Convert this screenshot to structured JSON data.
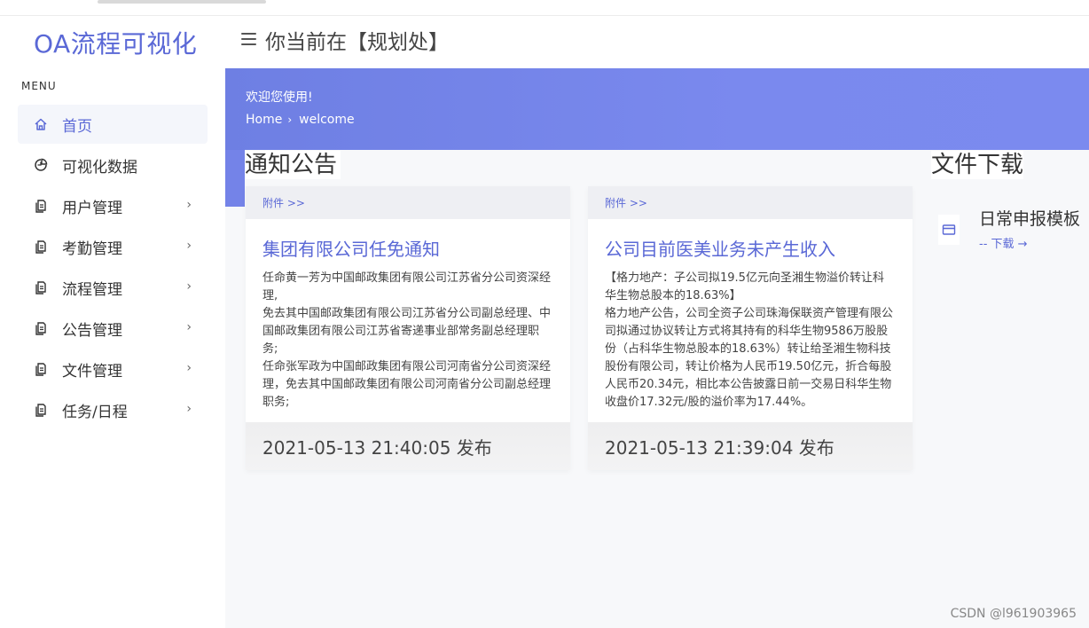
{
  "app": {
    "logo": "OA流程可视化"
  },
  "header": {
    "location": "你当前在【规划处】"
  },
  "sidebar": {
    "caption": "MENU",
    "items": [
      {
        "label": "首页",
        "icon": "home-icon",
        "active": true
      },
      {
        "label": "可视化数据",
        "icon": "chart-icon"
      },
      {
        "label": "用户管理",
        "icon": "document-icon",
        "chevron": "›"
      },
      {
        "label": "考勤管理",
        "icon": "document-icon",
        "chevron": "›"
      },
      {
        "label": "流程管理",
        "icon": "document-icon",
        "chevron": "›"
      },
      {
        "label": "公告管理",
        "icon": "document-icon",
        "chevron": "›"
      },
      {
        "label": "文件管理",
        "icon": "document-icon",
        "chevron": "›"
      },
      {
        "label": "任务/日程",
        "icon": "document-icon",
        "chevron": "›"
      }
    ]
  },
  "banner": {
    "welcome": "欢迎您使用!",
    "breadcrumb": {
      "home": "Home",
      "separator": "›",
      "current": "welcome"
    }
  },
  "notices": {
    "title": "通知公告",
    "cards": [
      {
        "attachment": "附件 >>",
        "title": "集团有限公司任免通知",
        "body": "任命黄一芳为中国邮政集团有限公司江苏省分公司资深经理,\n免去其中国邮政集团有限公司江苏省分公司副总经理、中国邮政集团有限公司江苏省寄递事业部常务副总经理职务;\n任命张军政为中国邮政集团有限公司河南省分公司资深经理，免去其中国邮政集团有限公司河南省分公司副总经理职务;",
        "footer": "2021-05-13 21:40:05 发布"
      },
      {
        "attachment": "附件 >>",
        "title": "公司目前医美业务未产生收入",
        "body": "【格力地产：子公司拟19.5亿元向圣湘生物溢价转让科华生物总股本的18.63%】\n格力地产公告，公司全资子公司珠海保联资产管理有限公司拟通过协议转让方式将其持有的科华生物9586万股股份（占科华生物总股本的18.63%）转让给圣湘生物科技股份有限公司，转让价格为人民币19.50亿元，折合每股人民币20.34元，相比本公告披露日前一交易日科华生物收盘价17.32元/股的溢价率为17.44%。",
        "footer": "2021-05-13 21:39:04 发布"
      }
    ]
  },
  "files": {
    "title": "文件下载",
    "items": [
      {
        "name": "日常申报模板",
        "link": "-- 下载 →"
      }
    ]
  },
  "watermark": "CSDN @l961903965",
  "colors": {
    "accent": "#5a68d6",
    "banner": "#7483e8"
  }
}
